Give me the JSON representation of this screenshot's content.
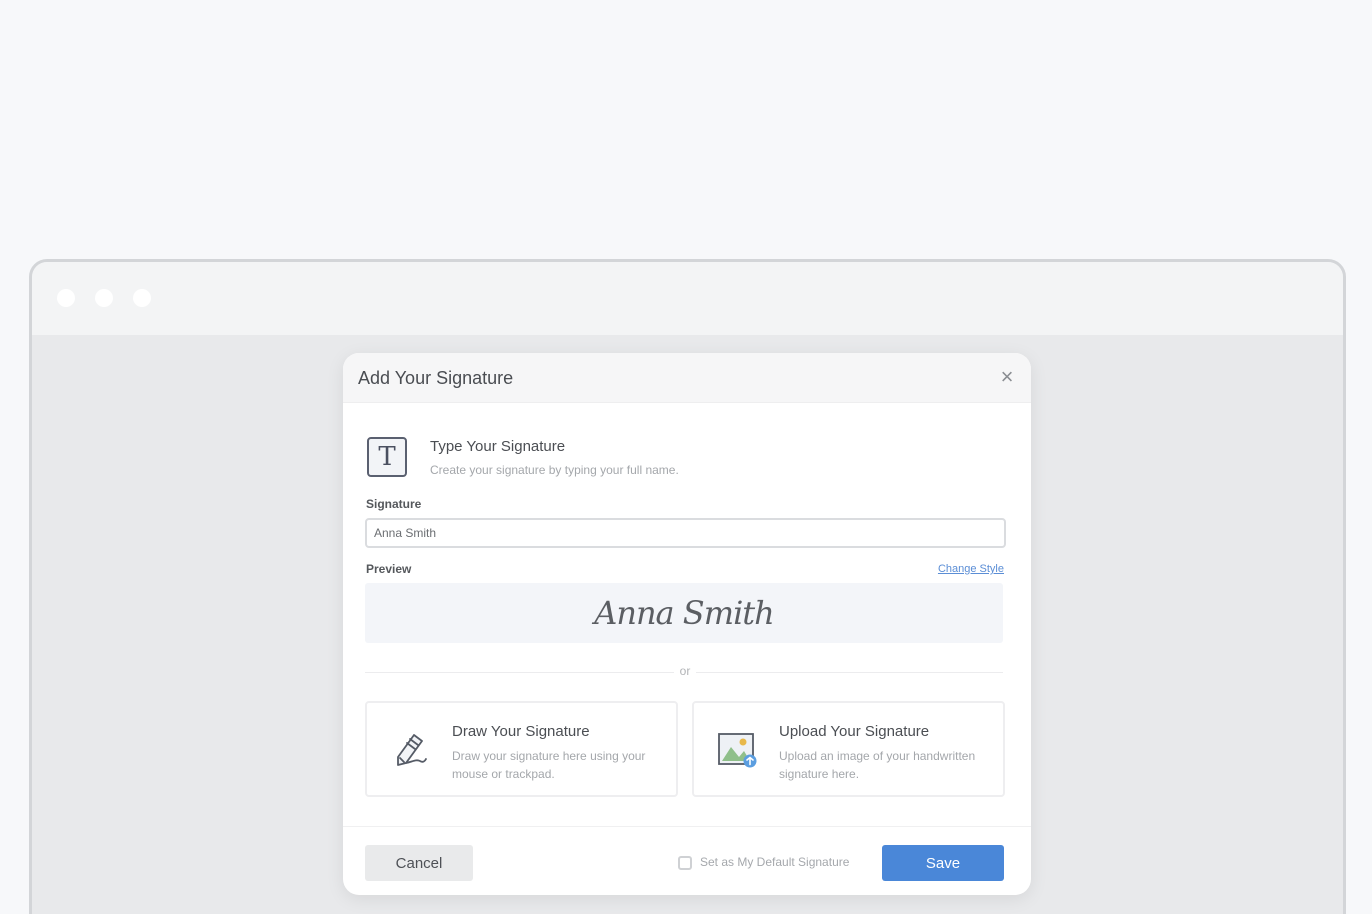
{
  "modal": {
    "title": "Add Your Signature",
    "close_glyph": "×"
  },
  "type_section": {
    "icon_glyph": "T",
    "title": "Type Your Signature",
    "description": "Create your signature by typing your full name."
  },
  "signature_field": {
    "label": "Signature",
    "value": "Anna Smith"
  },
  "preview": {
    "label": "Preview",
    "change_style_link": "Change Style",
    "text": "Anna Smith"
  },
  "divider": {
    "text": "or"
  },
  "options": {
    "draw": {
      "title": "Draw Your Signature",
      "description": "Draw your signature here using your mouse or trackpad."
    },
    "upload": {
      "title": "Upload Your Signature",
      "description": "Upload an image of your handwritten signature here."
    }
  },
  "footer": {
    "cancel_label": "Cancel",
    "default_checkbox_label": "Set as My Default Signature",
    "default_checked": false,
    "save_label": "Save"
  },
  "colors": {
    "accent": "#4a87d8",
    "page_bg": "#f7f8fa",
    "browser_bg": "#e8e9eb"
  },
  "icons": {
    "type": "text-t-icon",
    "draw": "pen-icon",
    "upload": "image-upload-icon",
    "close": "close-icon"
  }
}
